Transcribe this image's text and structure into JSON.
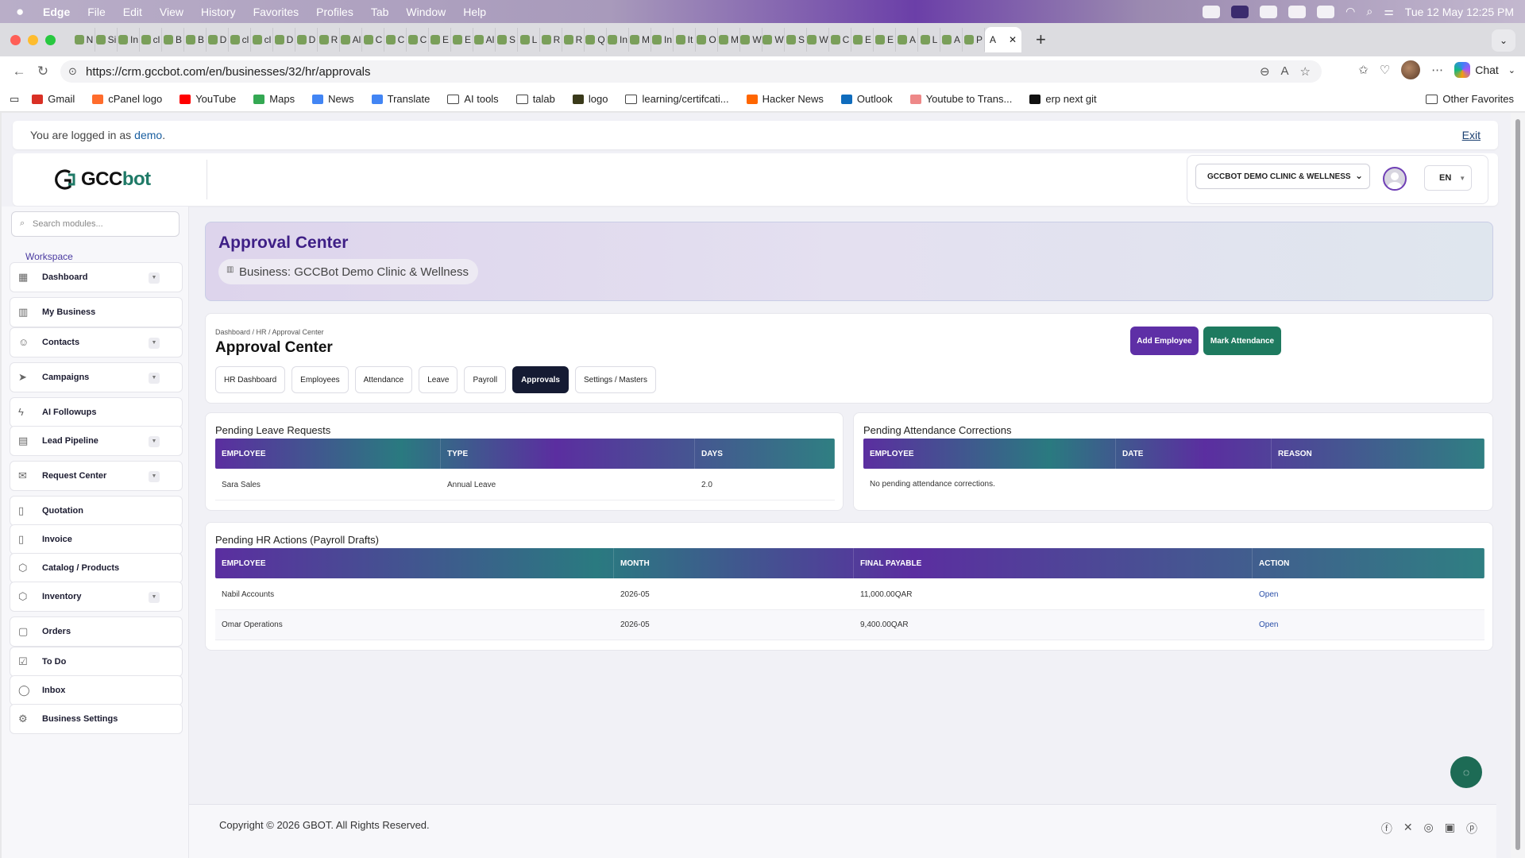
{
  "menubar": {
    "app": "Edge",
    "items": [
      "File",
      "Edit",
      "View",
      "History",
      "Favorites",
      "Profiles",
      "Tab",
      "Window",
      "Help"
    ],
    "clock": "Tue 12 May  12:25 PM"
  },
  "tabs": {
    "mini_letters": [
      "N",
      "Si",
      "In",
      "cl",
      "B",
      "B",
      "D",
      "cl",
      "cl",
      "D",
      "D",
      "R",
      "Al",
      "C",
      "C",
      "C",
      "E",
      "E",
      "Al",
      "S",
      "L",
      "R",
      "R",
      "Q",
      "In",
      "M",
      "In",
      "It",
      "O",
      "M",
      "W",
      "W",
      "S",
      "W",
      "C",
      "E",
      "E",
      "A",
      "L",
      "A",
      "P"
    ],
    "active_label": "A"
  },
  "address": {
    "url": "https://crm.gccbot.com/en/businesses/32/hr/approvals",
    "chat_label": "Chat"
  },
  "bookmarks": {
    "items": [
      {
        "label": "Gmail",
        "color": "#d93025"
      },
      {
        "label": "cPanel logo",
        "color": "#ff6c2c"
      },
      {
        "label": "YouTube",
        "color": "#ff0000"
      },
      {
        "label": "Maps",
        "color": "#34a853"
      },
      {
        "label": "News",
        "color": "#4285f4"
      },
      {
        "label": "Translate",
        "color": "#4285f4"
      },
      {
        "label": "AI tools",
        "color": "folder"
      },
      {
        "label": "talab",
        "color": "folder"
      },
      {
        "label": "logo",
        "color": "#3a3a1a"
      },
      {
        "label": "learning/certifcati...",
        "color": "folder"
      },
      {
        "label": "Hacker News",
        "color": "#ff6600"
      },
      {
        "label": "Outlook",
        "color": "#0f6cbd"
      },
      {
        "label": "Youtube to Trans...",
        "color": "#e88"
      },
      {
        "label": "erp next git",
        "color": "#111"
      }
    ],
    "other": "Other Favorites"
  },
  "session": {
    "prefix": "You are logged in as",
    "user": "demo",
    "suffix": ".",
    "exit": "Exit"
  },
  "brand": {
    "logo_main": "GCC",
    "logo_accent": "bot"
  },
  "header": {
    "business_select": "GCCBOT DEMO CLINIC & WELLNESS",
    "language": "EN"
  },
  "sidebar": {
    "search_placeholder": "Search modules...",
    "workspace": "Workspace",
    "items": [
      {
        "label": "Dashboard",
        "icon": "grid-icon",
        "glyph": "▦",
        "chevron": true
      },
      {
        "label": "My Business",
        "icon": "building-icon",
        "glyph": "▥",
        "chevron": false
      },
      {
        "label": "Contacts",
        "icon": "users-icon",
        "glyph": "☺",
        "chevron": true
      },
      {
        "label": "Campaigns",
        "icon": "send-icon",
        "glyph": "➤",
        "chevron": true
      },
      {
        "label": "AI Followups",
        "icon": "bolt-icon",
        "glyph": "ϟ",
        "chevron": false
      },
      {
        "label": "Lead Pipeline",
        "icon": "briefcase-icon",
        "glyph": "▤",
        "chevron": true
      },
      {
        "label": "Request Center",
        "icon": "inbox-icon",
        "glyph": "✉",
        "chevron": true
      },
      {
        "label": "Quotation",
        "icon": "file-dollar-icon",
        "glyph": "▯",
        "chevron": false
      },
      {
        "label": "Invoice",
        "icon": "file-text-icon",
        "glyph": "▯",
        "chevron": false
      },
      {
        "label": "Catalog / Products",
        "icon": "box-icon",
        "glyph": "⬡",
        "chevron": false
      },
      {
        "label": "Inventory",
        "icon": "package-icon",
        "glyph": "⬡",
        "chevron": true
      },
      {
        "label": "Orders",
        "icon": "bag-icon",
        "glyph": "▢",
        "chevron": false
      },
      {
        "label": "To Do",
        "icon": "checkbox-icon",
        "glyph": "☑",
        "chevron": false
      },
      {
        "label": "Inbox",
        "icon": "chat-icon",
        "glyph": "◯",
        "chevron": false
      },
      {
        "label": "Business Settings",
        "icon": "gear-icon",
        "glyph": "⚙",
        "chevron": false
      }
    ]
  },
  "hero": {
    "title": "Approval Center",
    "business": "Business: GCCBot Demo Clinic & Wellness"
  },
  "page_head": {
    "breadcrumb": "Dashboard / HR / Approval Center",
    "title": "Approval Center",
    "add_employee": "Add Employee",
    "mark_attendance": "Mark Attendance",
    "tabs": [
      "HR Dashboard",
      "Employees",
      "Attendance",
      "Leave",
      "Payroll",
      "Approvals",
      "Settings / Masters"
    ],
    "active_tab": "Approvals"
  },
  "leave_requests": {
    "title": "Pending Leave Requests",
    "columns": [
      "EMPLOYEE",
      "TYPE",
      "DAYS"
    ],
    "rows": [
      [
        "Sara Sales",
        "Annual Leave",
        "2.0"
      ]
    ]
  },
  "attendance_corrections": {
    "title": "Pending Attendance Corrections",
    "columns": [
      "EMPLOYEE",
      "DATE",
      "REASON"
    ],
    "empty": "No pending attendance corrections."
  },
  "hr_actions": {
    "title": "Pending HR Actions (Payroll Drafts)",
    "columns": [
      "EMPLOYEE",
      "MONTH",
      "FINAL PAYABLE",
      "ACTION"
    ],
    "rows": [
      [
        "Nabil Accounts",
        "2026-05",
        "11,000.00QAR",
        "Open"
      ],
      [
        "Omar Operations",
        "2026-05",
        "9,400.00QAR",
        "Open"
      ]
    ]
  },
  "footer": {
    "copyright": "Copyright © 2026 GBOT. All Rights Reserved.",
    "socials": [
      "facebook-icon",
      "x-icon",
      "instagram-icon",
      "linkedin-icon",
      "pinterest-icon"
    ]
  },
  "colors": {
    "brand_purple": "#5e2fa6",
    "brand_green": "#1e7a5f",
    "nav_active": "#151b33"
  }
}
